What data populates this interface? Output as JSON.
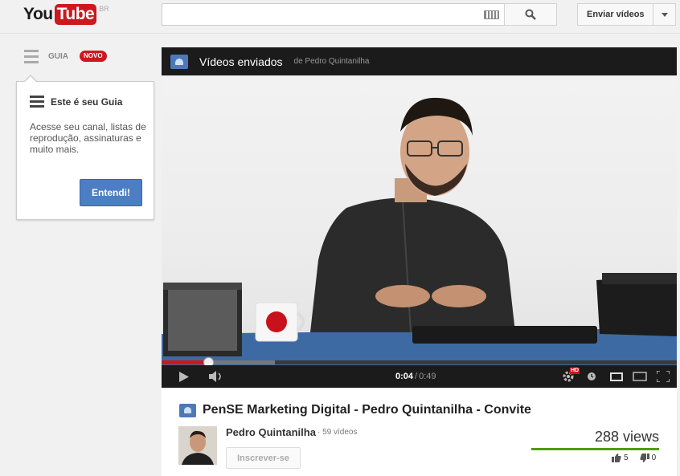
{
  "header": {
    "logo_you": "You",
    "logo_tube": "Tube",
    "country": "BR",
    "search_placeholder": "",
    "upload_label": "Enviar vídeos"
  },
  "guide": {
    "label": "GUIA",
    "badge": "NOVO",
    "popup": {
      "title": "Este é seu Guia",
      "text": "Acesse seu canal, listas de reprodução, assinaturas e muito mais.",
      "button": "Entendi!"
    }
  },
  "player": {
    "playlist_title": "Vídeos enviados",
    "playlist_by": "de Pedro Quintanilha",
    "current_time": "0:04",
    "separator": "/",
    "duration": "0:49",
    "progress_played": 0.09,
    "progress_buffered": 0.22,
    "hd_badge": "HD"
  },
  "video": {
    "title": "PenSE Marketing Digital - Pedro Quintanilha - Convite",
    "channel": "Pedro Quintanilha",
    "video_count": "· 59 vídeos",
    "subscribe": "Inscrever-se",
    "views": "288 views",
    "likes": "5",
    "dislikes": "0",
    "like_ratio": 1.0
  },
  "colors": {
    "brand_red": "#cc181e",
    "button_blue": "#4d7ec3",
    "like_green": "#559900"
  }
}
